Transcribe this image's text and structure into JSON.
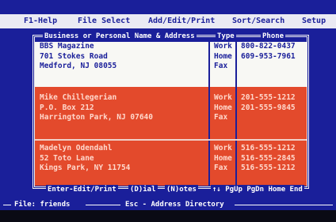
{
  "menu": {
    "help": "F1-Help",
    "file_select": "File Select",
    "add_edit_print": "Add/Edit/Print",
    "sort_search": "Sort/Search",
    "setup": "Setup"
  },
  "columns": {
    "name": "Business or Personal Name & Address",
    "type": "Type",
    "phone": "Phone"
  },
  "records": [
    {
      "lines": [
        "BBS Magazine",
        "701 Stokes Road",
        "Medford, NJ 08055"
      ],
      "types": [
        "Work",
        "Home",
        "Fax"
      ],
      "phones": [
        "800-822-0437",
        "",
        "609-953-7961"
      ]
    },
    {
      "lines": [
        "Mike Chillegerian",
        "P.O. Box 212",
        "Harrington Park, NJ 07640"
      ],
      "types": [
        "Work",
        "Home",
        "Fax"
      ],
      "phones": [
        "201-555-1212",
        "201-555-9845",
        ""
      ]
    },
    {
      "lines": [
        "Madelyn Odendahl",
        "52 Toto Lane",
        "Kings Park, NY 11754"
      ],
      "types": [
        "Work",
        "Home",
        "Fax"
      ],
      "phones": [
        "516-555-1212",
        "516-555-2845",
        "516-555-1212"
      ]
    }
  ],
  "status": {
    "enter": "Enter-Edit/Print",
    "dial": "(D)ial",
    "notes": "(N)otes",
    "nav": "↑↓ PgUp PgDn Home End"
  },
  "bottom": {
    "file": "File: friends",
    "esc": "Esc - Address Directory"
  },
  "colors": {
    "screen": "#1a1f9a",
    "highlight": "#e34a2c",
    "record": "#f8f8f4"
  }
}
